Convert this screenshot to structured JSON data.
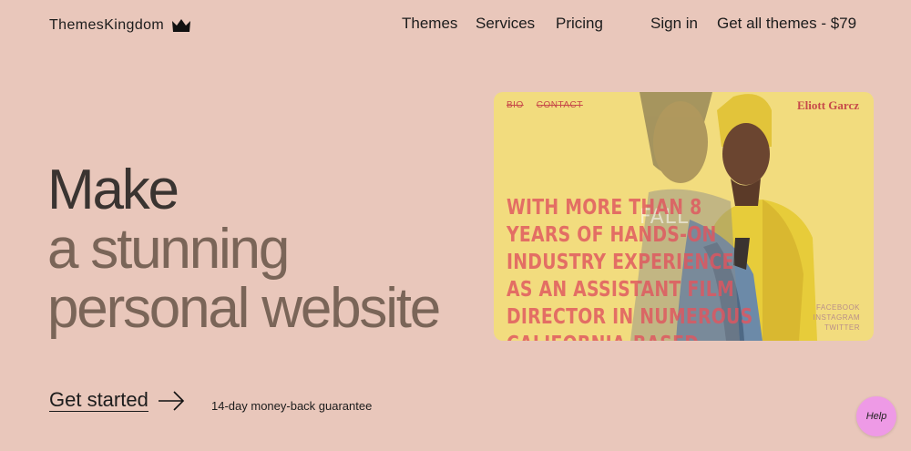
{
  "header": {
    "logo_text": "ThemesKingdom",
    "logo_icon": "crown-icon",
    "nav": {
      "themes": "Themes",
      "services": "Services",
      "pricing": "Pricing",
      "sign_in": "Sign in",
      "get_all": "Get all themes - $79"
    }
  },
  "hero": {
    "line1": "Make",
    "line2": "a stunning",
    "line3": "personal website",
    "cta_label": "Get started",
    "cta_icon": "arrow-right-icon",
    "guarantee": "14-day money-back guarantee"
  },
  "preview": {
    "nav_items": [
      "BIO",
      "CONTACT"
    ],
    "name": "Eliott Garcz",
    "overlay_word": "FALL",
    "text_lines": [
      "WITH MORE THAN 8",
      "YEARS OF HANDS-ON",
      "INDUSTRY EXPERIENCE",
      "AS AN ASSISTANT FILM",
      "DIRECTOR IN NUMEROUS",
      "CALIFORNIA-BASED"
    ],
    "social": [
      "FACEBOOK",
      "INSTAGRAM",
      "TWITTER"
    ]
  },
  "help": {
    "label": "Help"
  },
  "colors": {
    "background": "#e9c7bb",
    "headline_dark": "#3a3431",
    "headline_brown": "#7a6558",
    "preview_yellow": "#f2dc7e",
    "preview_text": "#e0565f",
    "help_bubble": "#ee9ae6"
  }
}
